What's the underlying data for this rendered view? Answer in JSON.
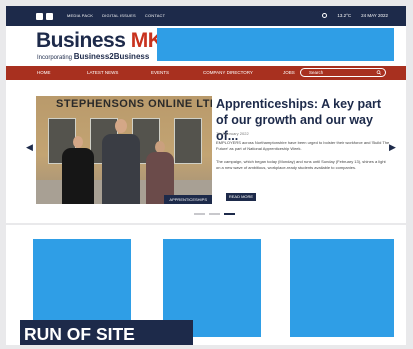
{
  "topbar": {
    "social": [
      "facebook-icon",
      "twitter-icon"
    ],
    "links": [
      "MEDIA PACK",
      "DIGITAL ISSUES",
      "CONTACT"
    ],
    "weather": "13.2°C",
    "date": "24 MAY 2022"
  },
  "logo": {
    "brand": "Business",
    "accent": "MK",
    "sub_prefix": "Incorporating",
    "sub_brand": "Business2Business"
  },
  "nav": {
    "items": [
      "HOME",
      "LATEST NEWS",
      "EVENTS",
      "COMPANY DIRECTORY",
      "JOBS"
    ],
    "search_placeholder": "Search"
  },
  "hero": {
    "sign_text": "STEPHENSONS ONLINE LTD",
    "image_caption": "APPRENTICESHIPS",
    "headline": "Apprenticeships: A key part of our growth and our way of...",
    "date": "7th February 2022",
    "paragraph1": "EMPLOYERS across Northamptonshire have been urged to bolster their workforce and 'Build The Future' as part of National Apprenticeship Week.",
    "paragraph2": "The campaign, which began today (Monday) and runs until Sunday (February 13), shines a light on a new wave of ambitious, workplace-ready students available to companies.",
    "read_more": "READ MORE",
    "slide_count": 3,
    "active_slide": 3
  },
  "ad_label": "RUN OF SITE",
  "colors": {
    "navy": "#1d2a4a",
    "brand_red": "#a8301f",
    "ad_blue": "#2f9ee6"
  }
}
